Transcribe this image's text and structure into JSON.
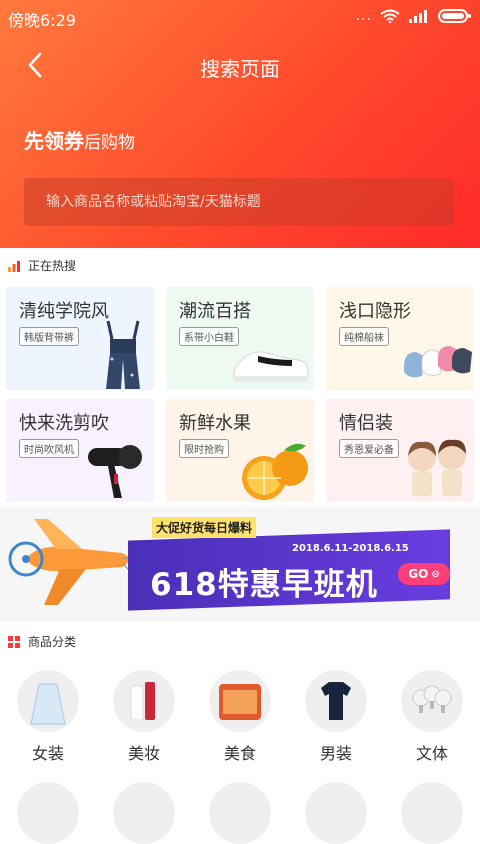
{
  "status_bar": {
    "time": "傍晚6:29",
    "signal": "...",
    "icons": [
      "wifi-icon",
      "cell-signal-icon",
      "battery-icon"
    ]
  },
  "nav": {
    "title": "搜索页面",
    "back_icon": "chevron-left-icon"
  },
  "hero": {
    "slogan_bold": "先领券",
    "slogan_rest": "后购物"
  },
  "search": {
    "placeholder": "输入商品名称或粘贴淘宝/天猫标题"
  },
  "hot_section": {
    "title": "正在热搜",
    "icon": "trending-bars-icon"
  },
  "hot_items": [
    {
      "name": "清纯学院风",
      "tag": "韩版背带裤",
      "bg": "#eef5ff"
    },
    {
      "name": "潮流百搭",
      "tag": "系带小白鞋",
      "bg": "#eefaf1"
    },
    {
      "name": "浅口隐形",
      "tag": "纯棉船袜",
      "bg": "#fff8e8"
    },
    {
      "name": "快来洗剪吹",
      "tag": "时尚吹风机",
      "bg": "#f8f1ff"
    },
    {
      "name": "新鲜水果",
      "tag": "限时抢购",
      "bg": "#fff4ea"
    },
    {
      "name": "情侣装",
      "tag": "秀恩爱必备",
      "bg": "#fff1f1"
    }
  ],
  "banner": {
    "headline": "大促好货每日爆料",
    "date_range": "2018.6.11-2018.6.15",
    "title": "618特惠早班机",
    "go_label": "GO"
  },
  "category_section": {
    "title": "商品分类",
    "icon": "category-grid-icon"
  },
  "categories": [
    {
      "label": "女装"
    },
    {
      "label": "美妆"
    },
    {
      "label": "美食"
    },
    {
      "label": "男装"
    },
    {
      "label": "文体"
    }
  ],
  "colors": {
    "header_start": "#ff7a3d",
    "header_end": "#ff2a2a",
    "accent": "#ff3f3f"
  }
}
